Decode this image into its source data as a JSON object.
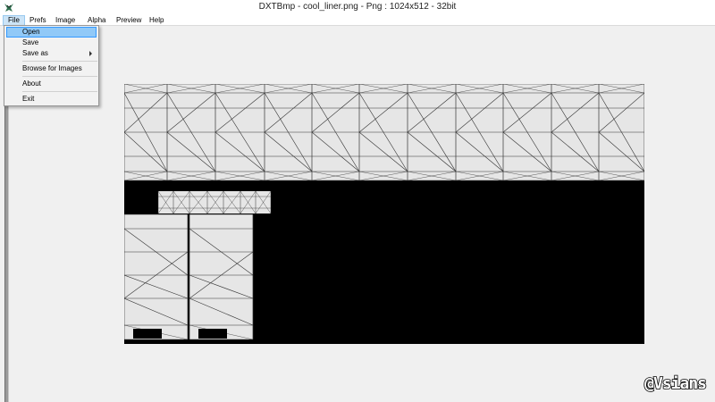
{
  "window": {
    "title": "DXTBmp - cool_liner.png - Png : 1024x512 - 32bit"
  },
  "menubar": {
    "items": [
      {
        "label": "File",
        "active": true
      },
      {
        "label": "Prefs"
      },
      {
        "label": "Image"
      },
      {
        "label": "Alpha"
      },
      {
        "label": "Preview"
      },
      {
        "label": "Help"
      }
    ]
  },
  "file_menu": {
    "items": [
      {
        "label": "Open",
        "highlighted": true
      },
      {
        "label": "Save"
      },
      {
        "label": "Save as",
        "has_submenu": true
      },
      {
        "label": "Browse for Images"
      },
      {
        "label": "About"
      },
      {
        "label": "Exit"
      }
    ]
  },
  "watermark": {
    "text": "@Vsians"
  },
  "colors": {
    "menu_highlight": "#91c9f7",
    "menu_highlight_border": "#3399ff",
    "menubar_active": "#cce4f7",
    "texture_fill": "#e6e6e6",
    "texture_background": "#000000"
  }
}
